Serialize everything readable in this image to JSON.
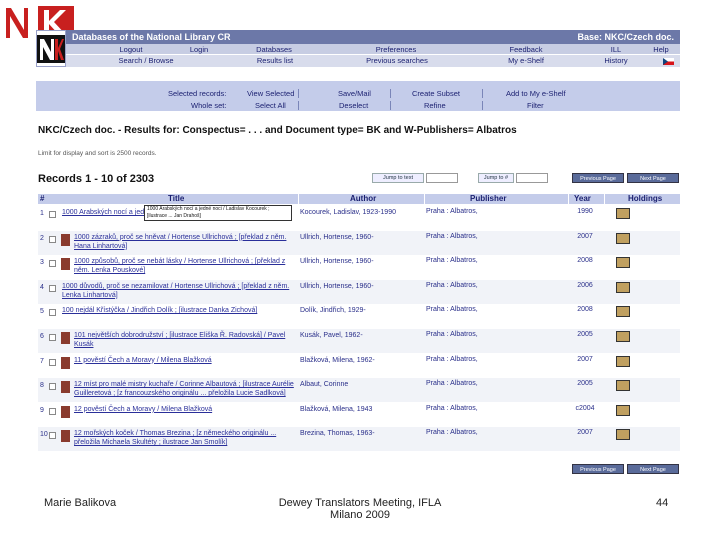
{
  "header": {
    "title": "Databases of the National Library CR",
    "base": "Base: NKC/Czech doc.",
    "row1": [
      "Logout",
      "Login",
      "Databases",
      "Preferences",
      "Feedback",
      "ILL",
      "Help"
    ],
    "row2": [
      "Search / Browse",
      "Results list",
      "Previous searches",
      "My e-Shelf",
      "History"
    ]
  },
  "action": {
    "selected_label": "Selected records:",
    "whole_label": "Whole set:",
    "view_selected": "View Selected",
    "save_mail": "Save/Mail",
    "create_subset": "Create Subset",
    "add_eshelf": "Add to My e-Shelf",
    "select_all": "Select All",
    "deselect": "Deselect",
    "refine": "Refine",
    "filter": "Filter"
  },
  "results": {
    "heading": "NKC/Czech doc. - Results for: Conspectus= . . . and Document type= BK and W-Publishers= Albatros",
    "limit_note": "Limit for display and sort is 2500 records.",
    "records": "Records 1 - 10 of 2303",
    "jump_text": "Jump to text",
    "jump_num": "Jump to #",
    "prev": "Previous Page",
    "next": "Next Page"
  },
  "table": {
    "headers": [
      "#",
      "Title",
      "Author",
      "Publisher",
      "Year",
      "Holdings"
    ],
    "rows": [
      {
        "num": "1",
        "title": "1000 Arabských nocí a jedné noci",
        "author": "Kocourek, Ladislav, 1923-1990",
        "publisher": "Praha : Albatros,",
        "year": "1990",
        "thumb": false
      },
      {
        "num": "2",
        "title": "1000 zázraků, proč se hněvat / Hortense Ullrichová ; [překlad z něm. Hana Linhartová]",
        "author": "Ullrich, Hortense, 1960-",
        "publisher": "Praha : Albatros,",
        "year": "2007",
        "thumb": true
      },
      {
        "num": "3",
        "title": "1000 způsobů, proč se nebát lásky / Hortense Ullrichová ; [překlad z něm. Lenka Pouskové]",
        "author": "Ullrich, Hortense, 1960-",
        "publisher": "Praha : Albatros,",
        "year": "2008",
        "thumb": true
      },
      {
        "num": "4",
        "title": "1000 důvodů, proč se nezamilovat / Hortense Ullrichová ; [překlad z něm. Lenka Linhartová]",
        "author": "Ullrich, Hortense, 1960-",
        "publisher": "Praha : Albatros,",
        "year": "2006",
        "thumb": false
      },
      {
        "num": "5",
        "title": "100 nejdál Křístýčka / Jindřich Dolík ; [ilustrace Danka Zichová]",
        "author": "Dolík, Jindřich, 1929-",
        "publisher": "Praha : Albatros,",
        "year": "2008",
        "thumb": false
      },
      {
        "num": "6",
        "title": "101 největších dobrodružství ; [ilustrace Eliška Ř. Radovská] / Pavel Kusák",
        "author": "Kusák, Pavel, 1962-",
        "publisher": "Praha : Albatros,",
        "year": "2005",
        "thumb": true
      },
      {
        "num": "7",
        "title": "11 pověstí Čech a Moravy / Milena Blažková",
        "author": "Blažková, Milena, 1962-",
        "publisher": "Praha : Albatros,",
        "year": "2007",
        "thumb": true
      },
      {
        "num": "8",
        "title": "12 míst pro malé mistry kuchaře / Corinne Albautová ; [ilustrace Aurélie Guilleretová ; [z francouzského originálu ... přeložila Lucie Sadlková]",
        "author": "Albaut, Corinne",
        "publisher": "Praha : Albatros,",
        "year": "2005",
        "thumb": true
      },
      {
        "num": "9",
        "title": "12 pověstí Čech a Moravy / Milena Blažková",
        "author": "Blažková, Milena, 1943",
        "publisher": "Praha : Albatros,",
        "year": "c2004",
        "thumb": true
      },
      {
        "num": "10",
        "title": "12 mořských koček / Thomas Brezina ; [z německého originálu ... přeložila Michaela Skultéty ; ilustrace Jan Smolík]",
        "author": "Brezina, Thomas, 1963-",
        "publisher": "Praha : Albatros,",
        "year": "2007",
        "thumb": true
      }
    ]
  },
  "tooltip": "1000 Arabských nocí a jedné noci / Ladislav Kocourek ; [ilustrace ... Jan Drahoš]",
  "footer": {
    "author": "Marie Balikova",
    "event_line1": "Dewey Translators Meeting, IFLA",
    "event_line2": "Milano 2009",
    "page": "44"
  }
}
